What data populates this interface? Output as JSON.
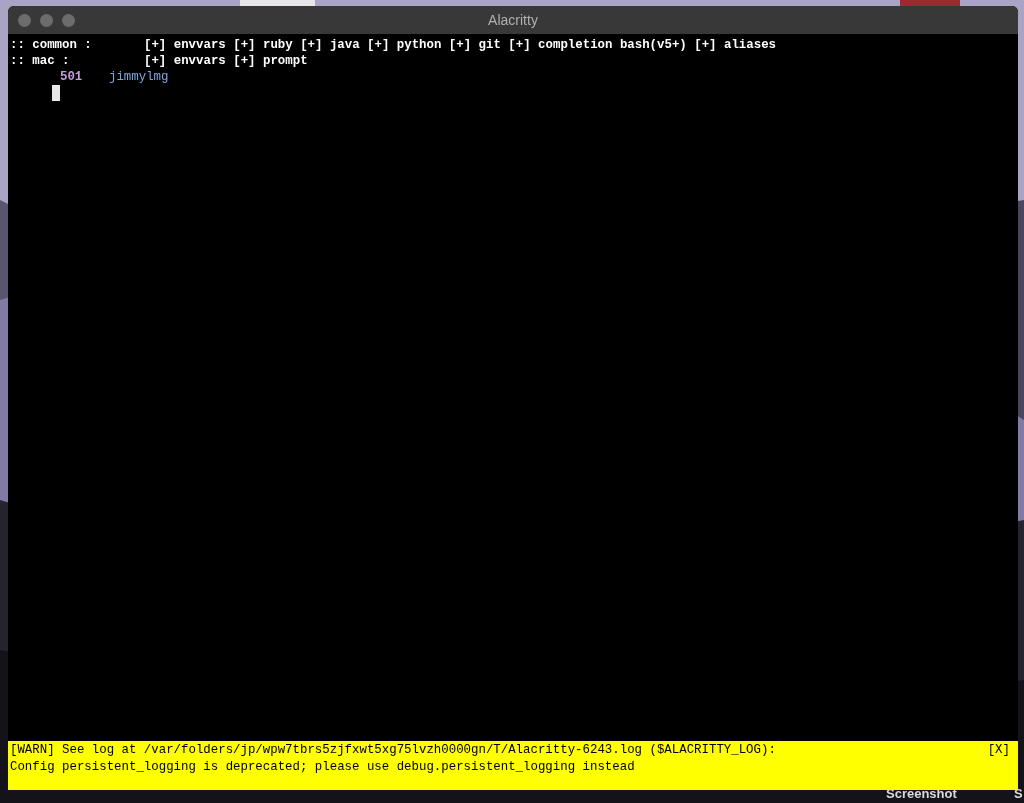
{
  "desktop": {
    "icon_labels": [
      "Screenshot",
      "S"
    ]
  },
  "window": {
    "title": "Alacritty"
  },
  "terminal": {
    "modules": [
      {
        "group": ":: common :",
        "items": "[+] envvars [+] ruby [+] java [+] python [+] git [+] completion bash(v5+) [+] aliases"
      },
      {
        "group": ":: mac :",
        "items": "[+] envvars [+] prompt"
      }
    ],
    "prompt": {
      "uid": "501",
      "user": "jimmylmg"
    },
    "cursor_visible": true
  },
  "warning": {
    "lines": [
      "[WARN] See log at /var/folders/jp/wpw7tbrs5zjfxwt5xg75lvzh0000gn/T/Alacritty-6243.log ($ALACRITTY_LOG):",
      "Config persistent_logging is deprecated; please use debug.persistent_logging instead"
    ],
    "close": "[X]"
  }
}
